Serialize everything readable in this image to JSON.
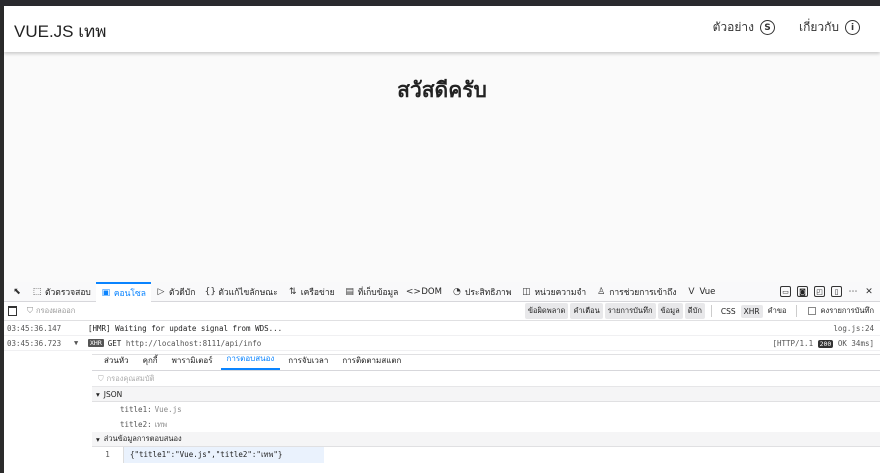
{
  "app": {
    "brand": "VUE.JS เทพ",
    "nav": [
      {
        "label": "ตัวอย่าง",
        "icon": "S"
      },
      {
        "label": "เกี่ยวกับ",
        "icon": "i"
      }
    ],
    "greeting": "สวัสดีครับ"
  },
  "devtools": {
    "tabs": [
      {
        "label": "ตัวตรวจสอบ",
        "icon": "⬚"
      },
      {
        "label": "คอนโซล",
        "icon": "▣"
      },
      {
        "label": "ตัวดีบัก",
        "icon": "▷"
      },
      {
        "label": "ตัวแก้ไขลักษณะ",
        "icon": "{}"
      },
      {
        "label": "เครือข่าย",
        "icon": "⇅"
      },
      {
        "label": "ที่เก็บข้อมูล",
        "icon": "▤"
      },
      {
        "label": "DOM",
        "icon": "<>"
      },
      {
        "label": "ประสิทธิภาพ",
        "icon": "◔"
      },
      {
        "label": "หน่วยความจำ",
        "icon": "◫"
      },
      {
        "label": "การช่วยการเข้าถึง",
        "icon": "♙"
      },
      {
        "label": "Vue",
        "icon": "V"
      }
    ],
    "filter_placeholder": "กรองผลออก",
    "filter_buttons": [
      "ข้อผิดพลาด",
      "คำเตือน",
      "รายการบันทึก",
      "ข้อมูล",
      "ดีบัก"
    ],
    "filter_buttons2": [
      "CSS",
      "XHR",
      "คำขอ"
    ],
    "persist_logs": "คงรายการบันทึก",
    "log_rows": [
      {
        "time": "03:45:36.147",
        "message": "[HMR] Waiting for update signal from WDS...",
        "source": "log.js:24"
      },
      {
        "time": "03:45:36.723",
        "badge": "XHR",
        "method": "GET",
        "url": "http://localhost:8111/api/info",
        "source": "[HTTP/1.1",
        "status": "200",
        "status_text": "OK 34ms]"
      }
    ],
    "xhr": {
      "tabs": [
        "ส่วนหัว",
        "คุกกี้",
        "พารามิเตอร์",
        "การตอบสนอง",
        "การจับเวลา",
        "การติดตามสแตก"
      ],
      "filter_placeholder": "กรองคุณสมบัติ",
      "json_section": "JSON",
      "json_fields": [
        {
          "key": "title1:",
          "value": "Vue.js"
        },
        {
          "key": "title2:",
          "value": "เทพ"
        }
      ],
      "payload_section": "ส่วนข้อมูลการตอบสนอง",
      "payload_line_number": "1",
      "payload": "{\"title1\":\"Vue.js\",\"title2\":\"เทพ\"}"
    }
  }
}
